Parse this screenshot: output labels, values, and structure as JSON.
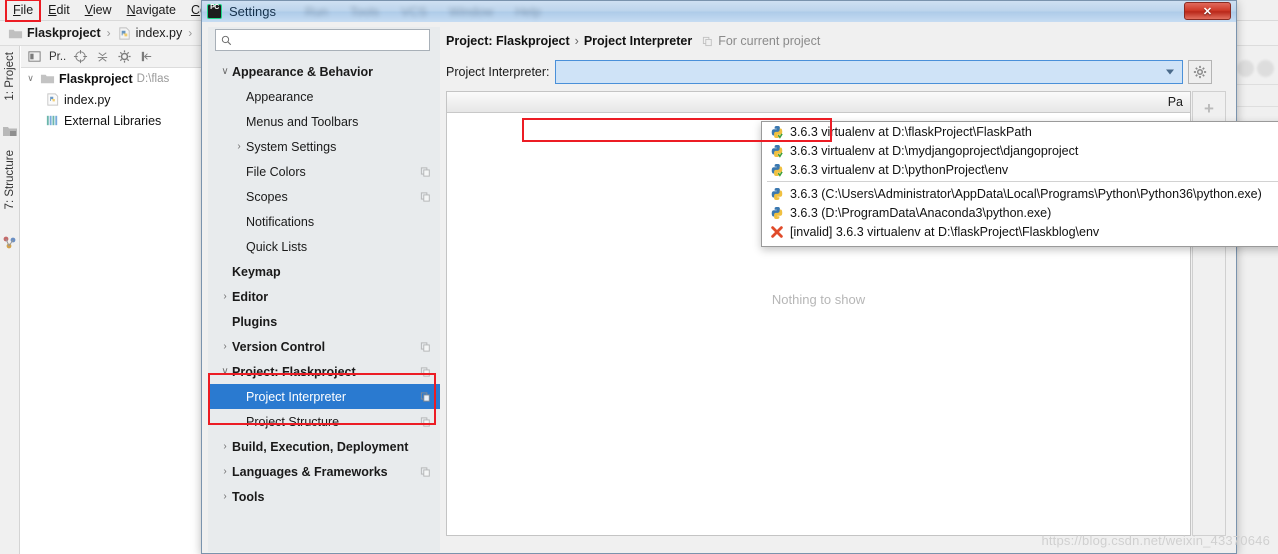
{
  "ide": {
    "menubar": [
      {
        "label": "File",
        "mnemonic": "F",
        "highlighted": true
      },
      {
        "label": "Edit",
        "mnemonic": "E",
        "highlighted": false
      },
      {
        "label": "View",
        "mnemonic": "V",
        "highlighted": false
      },
      {
        "label": "Navigate",
        "mnemonic": "N",
        "highlighted": false
      },
      {
        "label": "Cod",
        "mnemonic": "C",
        "highlighted": false
      }
    ],
    "breadcrumb": {
      "project": "Flaskproject",
      "separator": "›",
      "file": "index.py",
      "trailing_separator": "›"
    },
    "left_rail": {
      "project_tab": "1: Project",
      "structure_tab": "7: Structure"
    },
    "project_toolbar": {
      "selector_label": "Pr.."
    },
    "project_tree": [
      {
        "label": "Flaskproject",
        "path": "D:\\flas",
        "bold": true,
        "expanded": true,
        "icon": "folder-icon"
      },
      {
        "label": "index.py",
        "path": "",
        "bold": false,
        "expanded": false,
        "icon": "python-file-icon"
      },
      {
        "label": "External Libraries",
        "path": "",
        "bold": false,
        "expanded": false,
        "icon": "libraries-icon"
      }
    ]
  },
  "dialog": {
    "title": "Settings",
    "logo_text": "PC",
    "ghost_menu_items": [
      "Run",
      "Tools",
      "VCS",
      "Window",
      "Help"
    ],
    "close_label": "✕",
    "search": {
      "value": "",
      "placeholder": ""
    },
    "tree": [
      {
        "label": "Appearance & Behavior",
        "level": 0,
        "bold": true,
        "twisty": "∨",
        "selected": false,
        "copy_icon": false
      },
      {
        "label": "Appearance",
        "level": 1,
        "bold": false,
        "twisty": "",
        "selected": false,
        "copy_icon": false
      },
      {
        "label": "Menus and Toolbars",
        "level": 1,
        "bold": false,
        "twisty": "",
        "selected": false,
        "copy_icon": false
      },
      {
        "label": "System Settings",
        "level": 1,
        "bold": false,
        "twisty": "›",
        "selected": false,
        "copy_icon": false
      },
      {
        "label": "File Colors",
        "level": 1,
        "bold": false,
        "twisty": "",
        "selected": false,
        "copy_icon": true
      },
      {
        "label": "Scopes",
        "level": 1,
        "bold": false,
        "twisty": "",
        "selected": false,
        "copy_icon": true
      },
      {
        "label": "Notifications",
        "level": 1,
        "bold": false,
        "twisty": "",
        "selected": false,
        "copy_icon": false
      },
      {
        "label": "Quick Lists",
        "level": 1,
        "bold": false,
        "twisty": "",
        "selected": false,
        "copy_icon": false
      },
      {
        "label": "Keymap",
        "level": 0,
        "bold": true,
        "twisty": "",
        "selected": false,
        "copy_icon": false
      },
      {
        "label": "Editor",
        "level": 0,
        "bold": true,
        "twisty": "›",
        "selected": false,
        "copy_icon": false
      },
      {
        "label": "Plugins",
        "level": 0,
        "bold": true,
        "twisty": "",
        "selected": false,
        "copy_icon": false
      },
      {
        "label": "Version Control",
        "level": 0,
        "bold": true,
        "twisty": "›",
        "selected": false,
        "copy_icon": true
      },
      {
        "label": "Project: Flaskproject",
        "level": 0,
        "bold": true,
        "twisty": "∨",
        "selected": false,
        "copy_icon": true
      },
      {
        "label": "Project Interpreter",
        "level": 1,
        "bold": false,
        "twisty": "",
        "selected": true,
        "copy_icon": true
      },
      {
        "label": "Project Structure",
        "level": 1,
        "bold": false,
        "twisty": "",
        "selected": false,
        "copy_icon": true
      },
      {
        "label": "Build, Execution, Deployment",
        "level": 0,
        "bold": true,
        "twisty": "›",
        "selected": false,
        "copy_icon": false
      },
      {
        "label": "Languages & Frameworks",
        "level": 0,
        "bold": true,
        "twisty": "›",
        "selected": false,
        "copy_icon": true
      },
      {
        "label": "Tools",
        "level": 0,
        "bold": true,
        "twisty": "›",
        "selected": false,
        "copy_icon": false
      }
    ],
    "content": {
      "breadcrumb_root": "Project: Flaskproject",
      "breadcrumb_sep": "›",
      "breadcrumb_leaf": "Project Interpreter",
      "for_current_project": "For current project",
      "interpreter_label": "Project Interpreter:",
      "interpreter_value": "",
      "packages_column_header": "Pa",
      "empty_message": "Nothing to show",
      "side_buttons": [
        {
          "name": "add",
          "glyph": "+"
        },
        {
          "name": "remove",
          "glyph": "−"
        },
        {
          "name": "upgrade",
          "glyph": "↑"
        }
      ]
    },
    "dropdown": {
      "items": [
        {
          "text": "3.6.3 virtualenv at D:\\flaskProject\\FlaskPath",
          "icon": "python-venv-icon",
          "highlighted": true,
          "separator_after": false
        },
        {
          "text": "3.6.3 virtualenv at D:\\mydjangoproject\\djangoproject",
          "icon": "python-venv-icon",
          "highlighted": false,
          "separator_after": false
        },
        {
          "text": "3.6.3 virtualenv at D:\\pythonProject\\env",
          "icon": "python-venv-icon",
          "highlighted": false,
          "separator_after": true
        },
        {
          "text": "3.6.3 (C:\\Users\\Administrator\\AppData\\Local\\Programs\\Python\\Python36\\python.exe)",
          "icon": "python-icon",
          "highlighted": false,
          "separator_after": false
        },
        {
          "text": "3.6.3 (D:\\ProgramData\\Anaconda3\\python.exe)",
          "icon": "python-icon",
          "highlighted": false,
          "separator_after": false
        },
        {
          "text": "[invalid] 3.6.3 virtualenv at D:\\flaskProject\\Flaskblog\\env",
          "icon": "invalid-icon",
          "highlighted": false,
          "separator_after": false
        }
      ]
    }
  },
  "watermark": "https://blog.csdn.net/weixin_43370646",
  "colors": {
    "selection_blue": "#2a7ad0",
    "annotation_red": "#ec1c24",
    "combo_fill": "#cfe3f7",
    "tree_bg": "#e8ebed"
  }
}
